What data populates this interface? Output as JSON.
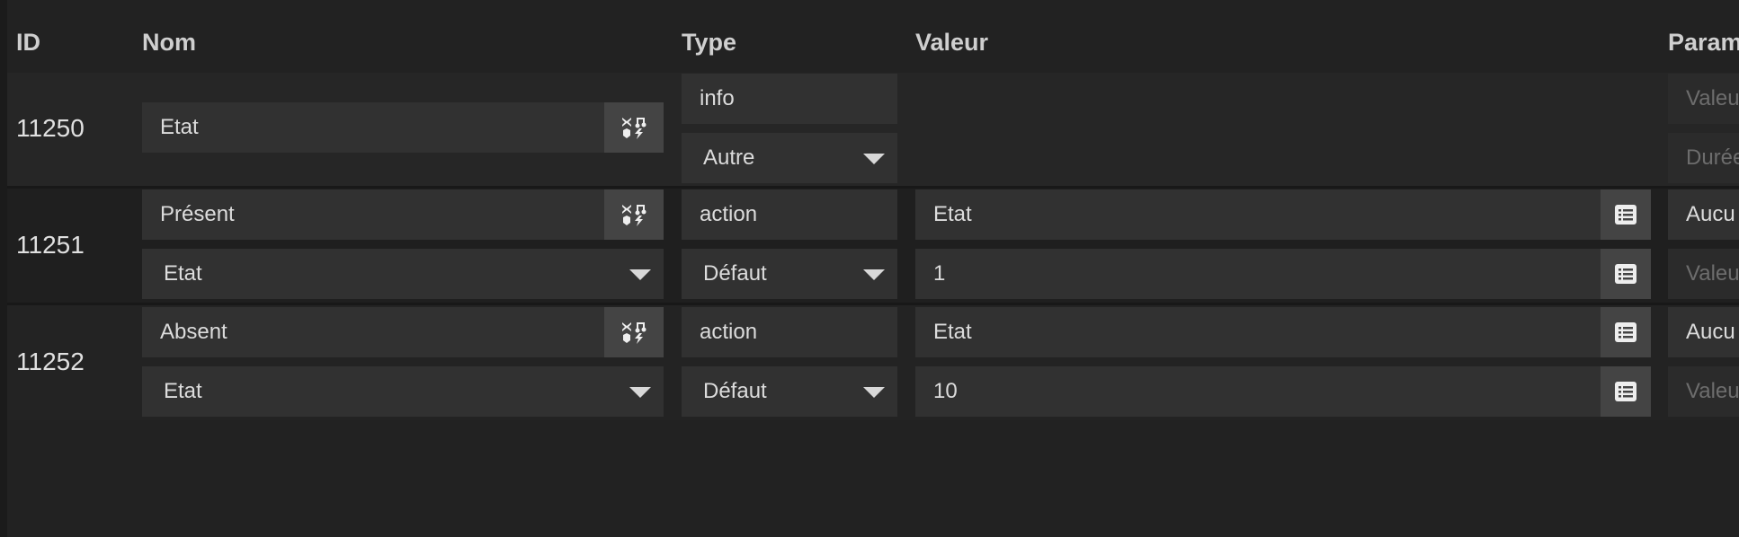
{
  "table": {
    "headers": {
      "id": "ID",
      "nom": "Nom",
      "type": "Type",
      "valeur": "Valeur",
      "param": "Param"
    },
    "rows": [
      {
        "id": "11250",
        "name": "Etat",
        "type": "info",
        "subtype": "Autre",
        "param_top_placeholder": "Valeu",
        "param_bottom_placeholder": "Durée"
      },
      {
        "id": "11251",
        "name": "Présent",
        "linked_info": "Etat",
        "type": "action",
        "subtype": "Défaut",
        "value_top": "Etat",
        "value_bottom": "1",
        "param_top": "Aucu",
        "param_bottom_placeholder": "Valeu"
      },
      {
        "id": "11252",
        "name": "Absent",
        "linked_info": "Etat",
        "type": "action",
        "subtype": "Défaut",
        "value_top": "Etat",
        "value_bottom": "10",
        "param_top": "Aucu",
        "param_bottom_placeholder": "Valeu"
      }
    ]
  },
  "icons": {
    "name_addon": "icon-selector-icon",
    "value_addon": "list-icon"
  }
}
